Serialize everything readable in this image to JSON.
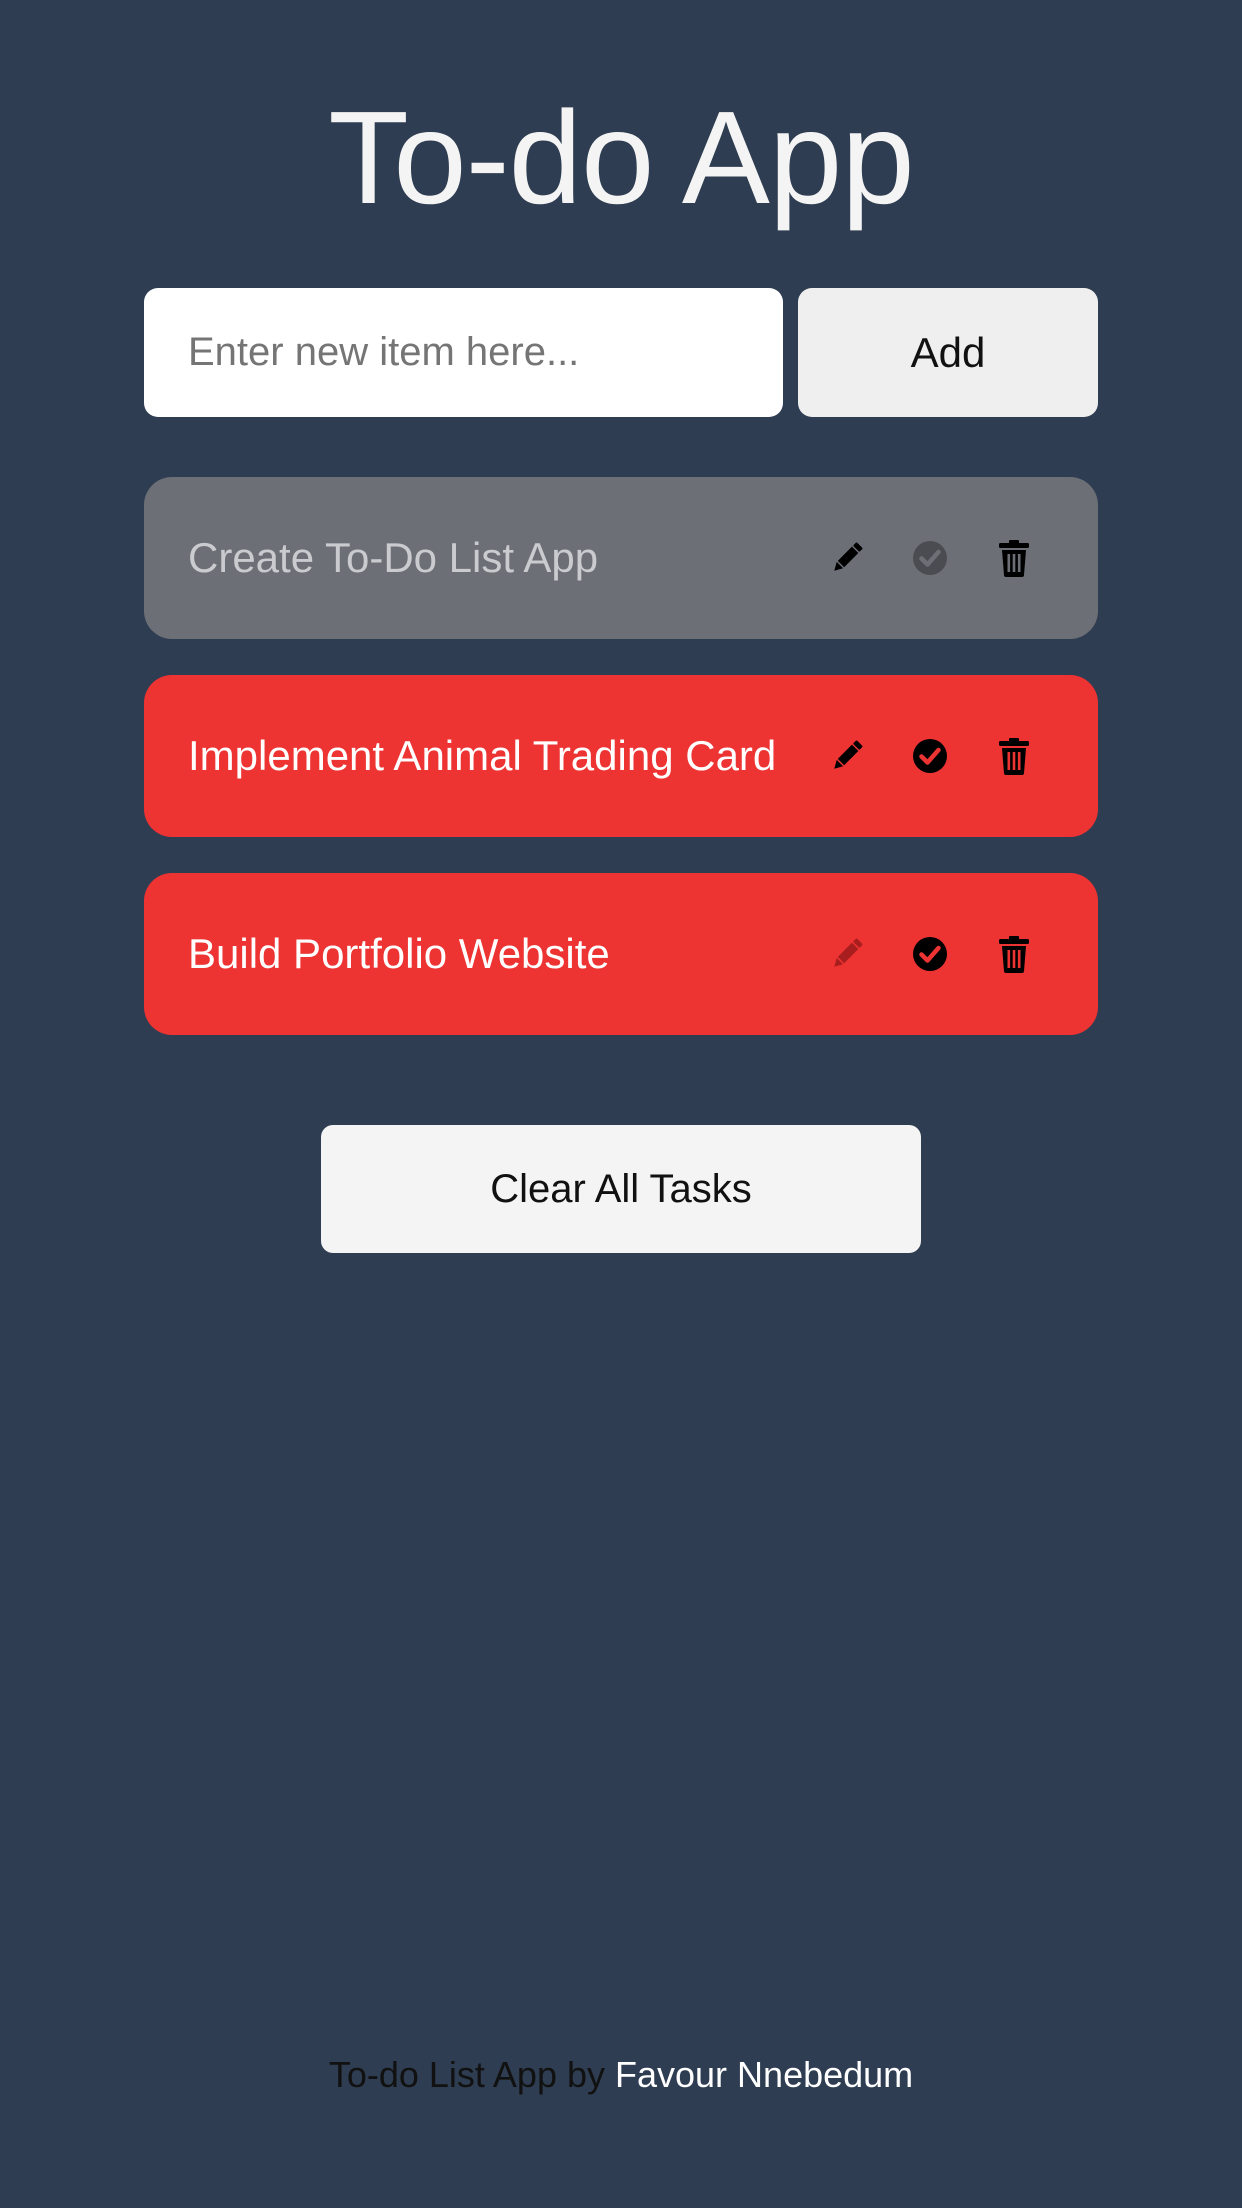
{
  "app": {
    "title": "To-do App"
  },
  "new_item": {
    "placeholder": "Enter new item here...",
    "value": "",
    "add_label": "Add"
  },
  "tasks": [
    {
      "label": "Create To-Do List App",
      "completed": true,
      "color": "#6c6f76"
    },
    {
      "label": "Implement Animal Trading Card",
      "completed": false,
      "color": "#ee3333"
    },
    {
      "label": "Build Portfolio Website",
      "completed": false,
      "color": "#ee3333"
    }
  ],
  "task_actions": {
    "edit_icon": "pencil-icon",
    "complete_icon": "check-circle-icon",
    "delete_icon": "trash-icon"
  },
  "clear_all_label": "Clear All Tasks",
  "footer": {
    "prefix": "To-do List App by ",
    "author": "Favour Nnebedum"
  },
  "colors": {
    "background": "#2e3d51",
    "pending_task": "#ee3333",
    "completed_task": "#6c6f76"
  }
}
